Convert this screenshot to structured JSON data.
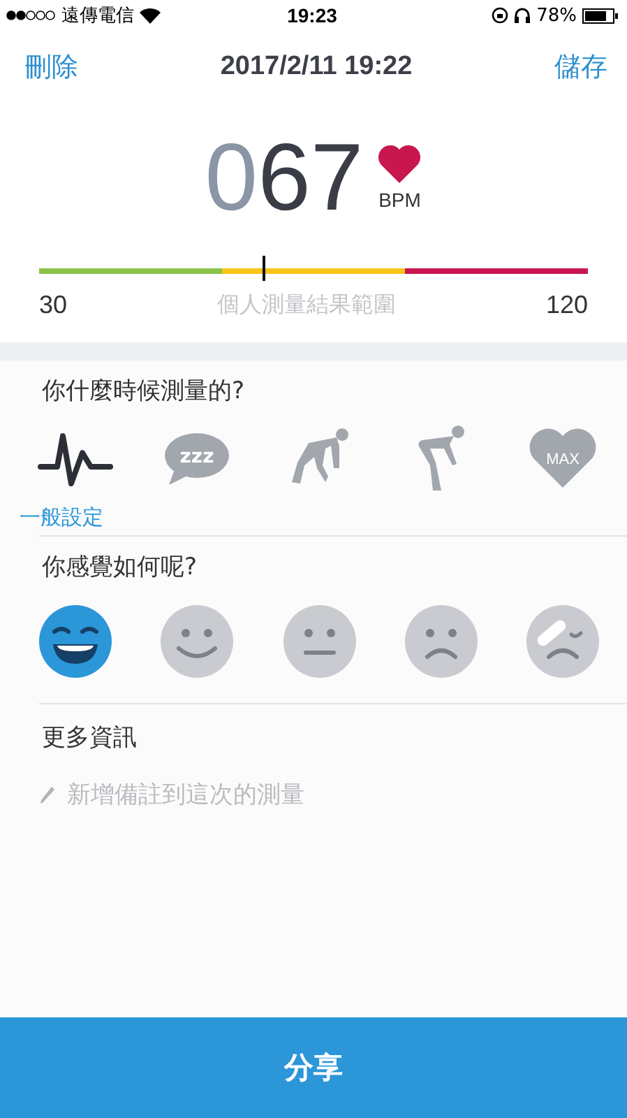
{
  "status_bar": {
    "carrier": "遠傳電信",
    "time": "19:23",
    "battery": "78%"
  },
  "nav": {
    "left": "刪除",
    "title": "2017/2/11 19:22",
    "right": "儲存"
  },
  "reading": {
    "dim_digits": "0",
    "digits": "67",
    "unit": "BPM"
  },
  "range": {
    "min": "30",
    "max": "120",
    "caption": "個人測量結果範圍",
    "level": 0.41,
    "zones": [
      {
        "color": "#8bc34a"
      },
      {
        "color": "#f5c518"
      },
      {
        "color": "#c8174f"
      }
    ]
  },
  "moment": {
    "question": "你什麼時候測量的?",
    "selected_caption": "一般設定",
    "options": [
      {
        "kind": "pulse",
        "selected": true
      },
      {
        "kind": "sleep",
        "text": "zzz",
        "selected": false
      },
      {
        "kind": "crouch",
        "selected": false
      },
      {
        "kind": "bent",
        "selected": false
      },
      {
        "kind": "max",
        "text": "MAX",
        "selected": false
      }
    ]
  },
  "feeling": {
    "question": "你感覺如何呢?",
    "options": [
      {
        "kind": "grin",
        "selected": true
      },
      {
        "kind": "smile",
        "selected": false
      },
      {
        "kind": "neutral",
        "selected": false
      },
      {
        "kind": "sad",
        "selected": false
      },
      {
        "kind": "hurt",
        "selected": false
      }
    ]
  },
  "more": {
    "heading": "更多資訊",
    "placeholder": "新增備註到這次的測量"
  },
  "share_button": "分享"
}
